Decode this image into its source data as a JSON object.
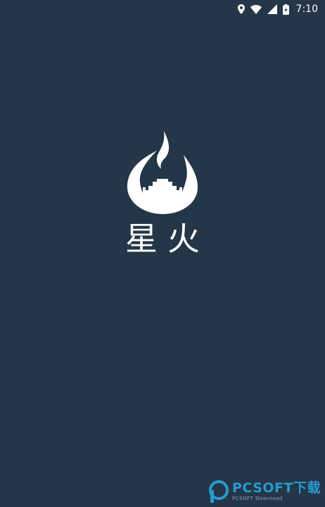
{
  "status_bar": {
    "time": "7:10",
    "icons": [
      "location-icon",
      "wifi-icon",
      "signal-icon",
      "battery-icon"
    ]
  },
  "splash": {
    "app_name": "星火",
    "logo_icon": "flame-castle-logo-icon"
  },
  "watermark": {
    "main": "PCSOFT下载",
    "sub": "PCSOFT Download"
  },
  "colors": {
    "background": "#243647",
    "foreground": "#ffffff",
    "watermark_accent": "#2aa3dc"
  }
}
